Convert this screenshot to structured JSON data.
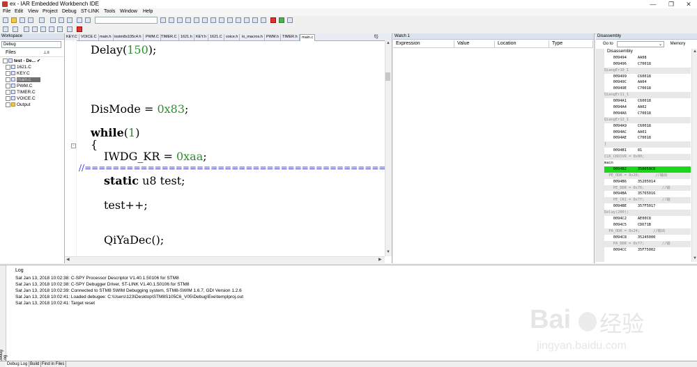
{
  "window": {
    "title": "ex - IAR Embedded Workbench IDE",
    "buttons": [
      "—",
      "❐",
      "✕"
    ]
  },
  "menu": [
    "File",
    "Edit",
    "View",
    "Project",
    "Debug",
    "ST-LINK",
    "Tools",
    "Window",
    "Help"
  ],
  "workspace": {
    "header": "Workspace",
    "config": "Debug",
    "files_label": "Files",
    "tree": [
      {
        "label": "test - De...",
        "checked": "✔"
      },
      {
        "label": "1621.C"
      },
      {
        "label": "KEY.C"
      },
      {
        "label": "main.c"
      },
      {
        "label": "PWM.C"
      },
      {
        "label": "TIMER.C"
      },
      {
        "label": "VOICE.C"
      },
      {
        "label": "Output"
      }
    ],
    "tab": "test"
  },
  "editor": {
    "tabs": [
      "KEY.C",
      "VOICE.C",
      "main.h",
      "iostm8s105c4.h",
      "PWM.C",
      "TIMER.C",
      "1621.h",
      "KEY.h",
      "1621.C",
      "voice.h",
      "io_macros.h",
      "PWM.h",
      "TIMER.h",
      "main.c"
    ],
    "active_tab": "main.c",
    "fn_indicator": "f()",
    "lines": {
      "l1_fn": "Delay(",
      "l1_num": "150",
      "l1_end": ");",
      "l2_var": "DisMode = ",
      "l2_num": "0x83",
      "l2_end": ";",
      "l3_kw": "while",
      "l3_open": "(",
      "l3_num": "1",
      "l3_close": ")",
      "l4": "{",
      "l5_var": "IWDG_KR = ",
      "l5_num": "0xaa",
      "l5_end": ";",
      "l6": "//==================================================",
      "l7_kw": "static",
      "l7_rest": " u8 test;",
      "l8": "test++;",
      "l9": "QiYaDec();"
    }
  },
  "watch": {
    "header": "Watch 1",
    "columns": [
      "Expression",
      "Value",
      "Location",
      "Type"
    ]
  },
  "disassembly": {
    "header": "Disassembly",
    "goto": "Go to",
    "memory": "Memory",
    "title": "Disassembly",
    "lines": [
      {
        "t": "    009494     AA08",
        "k": ""
      },
      {
        "t": "    009496     C70018",
        "k": ""
      },
      {
        "t": "QiangEr10_1",
        "k": "src"
      },
      {
        "t": "    009499     C60018",
        "k": ""
      },
      {
        "t": "    00949C     AA04",
        "k": ""
      },
      {
        "t": "    00949E     C70018",
        "k": ""
      },
      {
        "t": "QiangEr11_1",
        "k": "src"
      },
      {
        "t": "    0094A1     C60018",
        "k": ""
      },
      {
        "t": "    0094A4     AA02",
        "k": ""
      },
      {
        "t": "    0094A6     C70018",
        "k": ""
      },
      {
        "t": "QiangEr12_1",
        "k": "src"
      },
      {
        "t": "    0094A9     C60018",
        "k": ""
      },
      {
        "t": "    0094AC     AA01",
        "k": ""
      },
      {
        "t": "    0094AE     C70018",
        "k": ""
      },
      {
        "t": "}",
        "k": "src"
      },
      {
        "t": "    0094B1     81",
        "k": ""
      },
      {
        "t": "CLK_CKDIVR = 0x00;",
        "k": "src"
      },
      {
        "t": "main",
        "k": ""
      },
      {
        "t": "    0094B2     350050C6",
        "k": "cur"
      },
      {
        "t": "  PE_ODR = 0x28;       //输出",
        "k": "src"
      },
      {
        "t": "    0094B6     35205014",
        "k": ""
      },
      {
        "t": "    PE_DDR = 0x76;        //输",
        "k": "src"
      },
      {
        "t": "    0094BA     35765016",
        "k": ""
      },
      {
        "t": "    PE_CR1 = 0x7f;        //输",
        "k": "src"
      },
      {
        "t": "    0094BE     357F5017",
        "k": ""
      },
      {
        "t": "Delay(200);",
        "k": "src"
      },
      {
        "t": "    0094C2     AE00C8",
        "k": ""
      },
      {
        "t": "    0094C5     CDD71B",
        "k": ""
      },
      {
        "t": "  PA_ODR = 0x24;      //输出",
        "k": "src"
      },
      {
        "t": "    0094C8     35245000",
        "k": ""
      },
      {
        "t": "    PA_DDR = 0xf7;        //输",
        "k": "src"
      },
      {
        "t": "    0094CC     35F75002",
        "k": ""
      }
    ]
  },
  "log": {
    "side_label": "Debug Log",
    "title": "Log",
    "lines": [
      "Sat Jan 13, 2018 10:02:38: C-SPY Processor Descriptor V1.40.1.50106 for STM8",
      "Sat Jan 13, 2018 10:02:38: C-SPY Debugger Driver, ST-LINK V1.40.1.50106 for STM8",
      "Sat Jan 13, 2018 10:02:39: Connected to STM8 SWIM Debugging system, STM8-SWIM 1.6.7, GDI Version 1.2.6",
      "Sat Jan 13, 2018 10:02:41: Loaded debugee: C:\\Users\\123\\Desktop\\STM8S105C6_V05\\Debug\\Exe\\templproj.out",
      "Sat Jan 13, 2018 10:02:41: Target reset"
    ],
    "tabs": [
      "Debug Log",
      "Build",
      "Find in Files"
    ]
  },
  "watermark": {
    "brand": "Bai",
    "cn": "经验",
    "url": "jingyan.baidu.com"
  }
}
